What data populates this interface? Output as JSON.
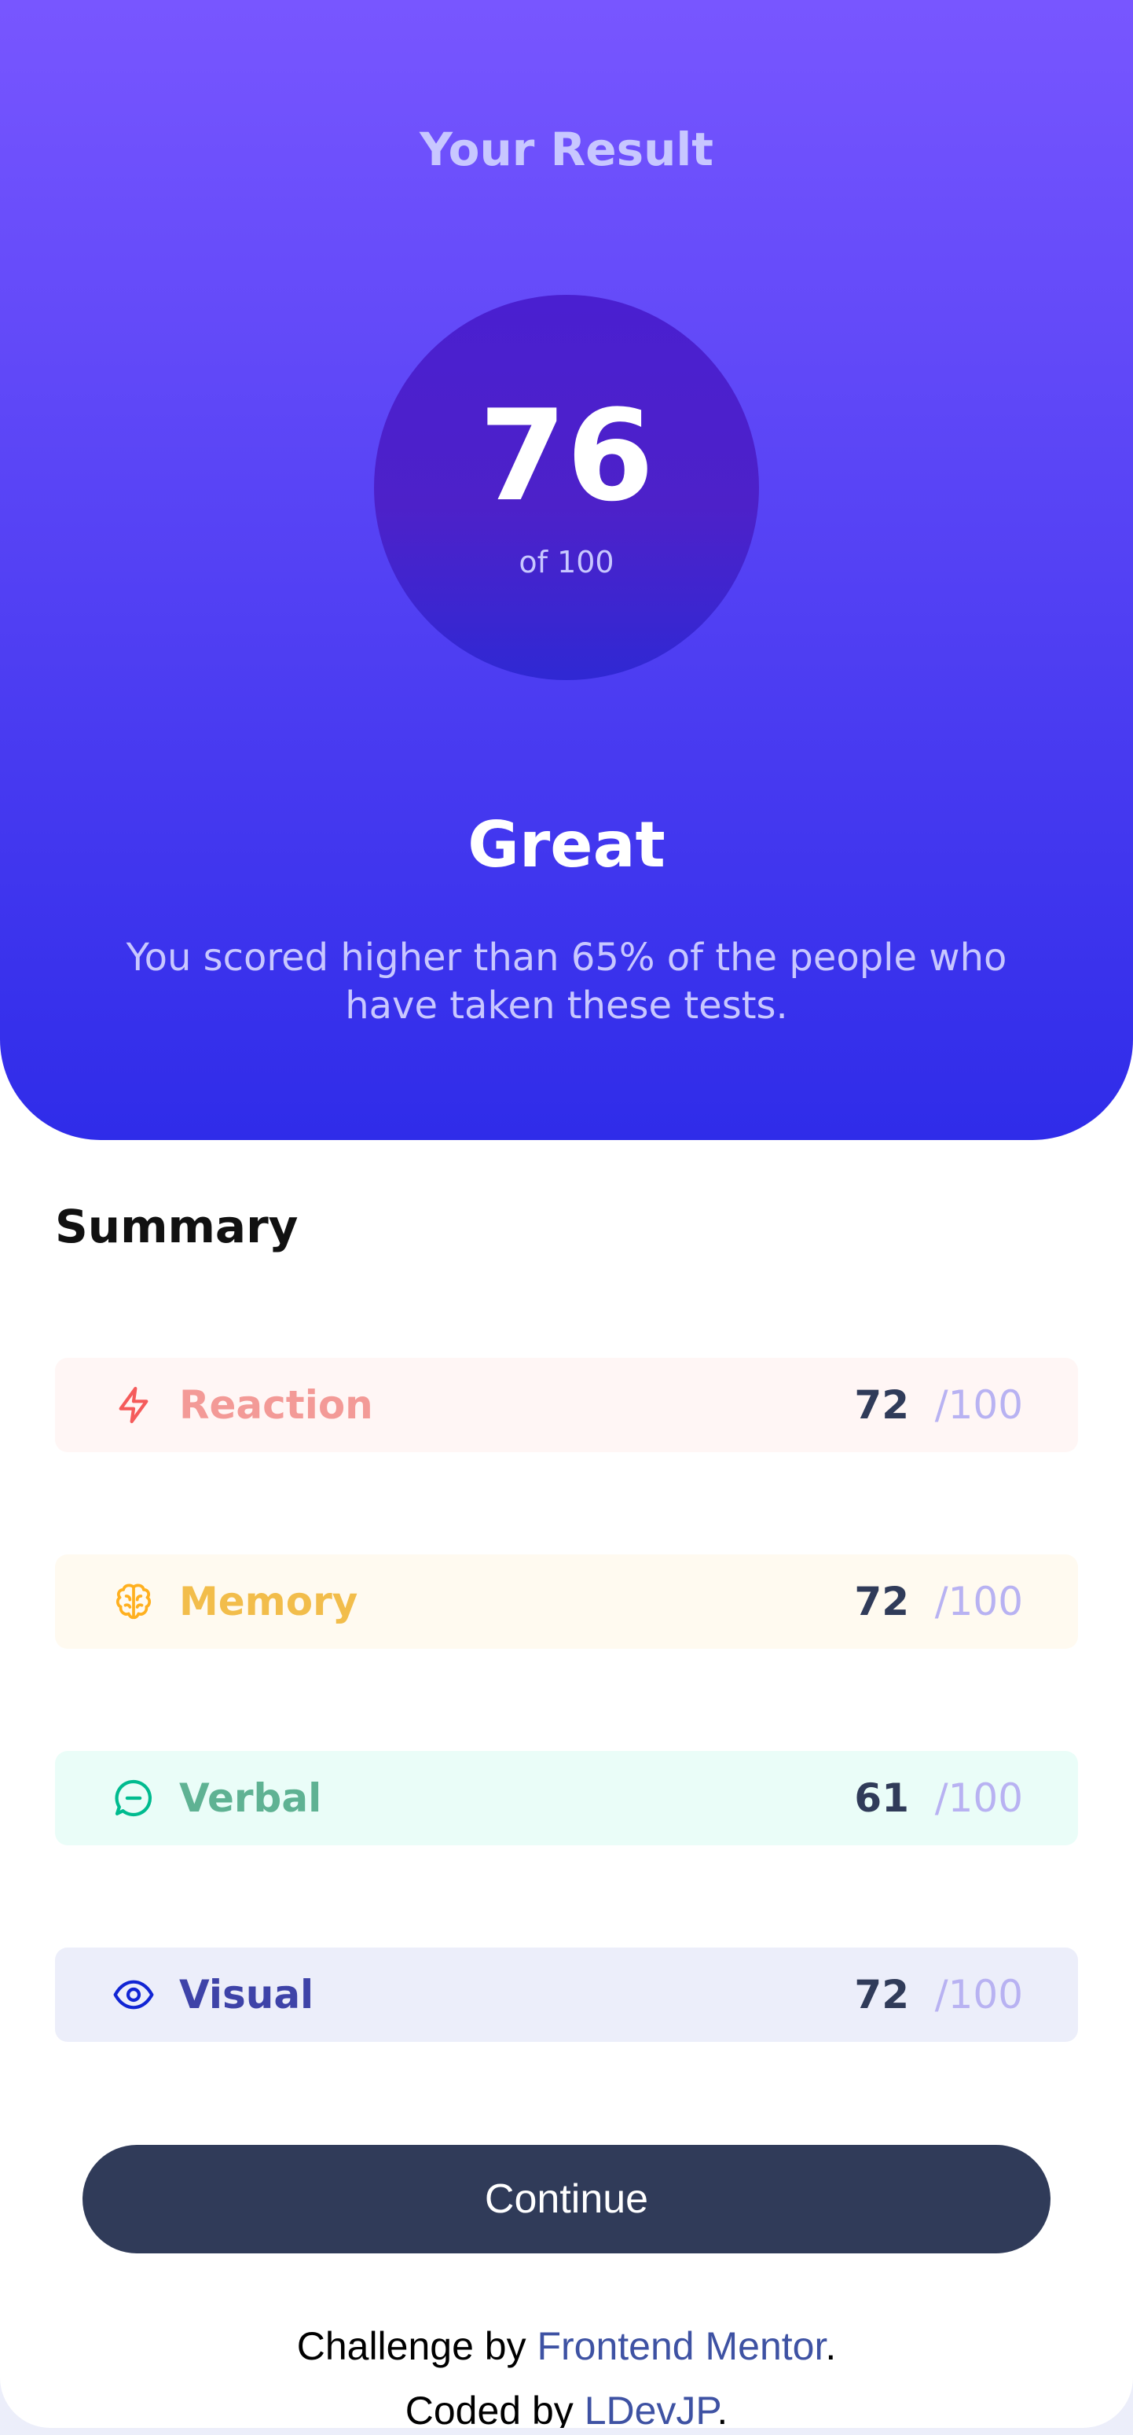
{
  "result": {
    "title": "Your Result",
    "score": "76",
    "of_label": "of 100",
    "rating": "Great",
    "description": "You scored higher than 65% of the people who have taken these tests."
  },
  "summary": {
    "title": "Summary",
    "items": [
      {
        "label": "Reaction",
        "score": "72",
        "max": "/100",
        "icon": "lightning-icon",
        "color": "#F55B5B",
        "background": "#FFF6F5"
      },
      {
        "label": "Memory",
        "score": "72",
        "max": "/100",
        "icon": "brain-icon",
        "color": "#FFB01F",
        "background": "#FFFAF0"
      },
      {
        "label": "Verbal",
        "score": "61",
        "max": "/100",
        "icon": "speech-bubble-icon",
        "color": "#00BB8F",
        "background": "#EAFDF8"
      },
      {
        "label": "Visual",
        "score": "72",
        "max": "/100",
        "icon": "eye-icon",
        "color": "#1125D4",
        "background": "#ECEEFA"
      }
    ]
  },
  "continue_button": "Continue",
  "attribution": {
    "line1_prefix": "Challenge by ",
    "line1_link": "Frontend Mentor",
    "line1_suffix": ".",
    "line2_prefix": "Coded by ",
    "line2_link": "LDevJP",
    "line2_suffix": "."
  },
  "colors": {
    "gradient_top": "#7856FF",
    "gradient_bottom": "#2F2CE9",
    "circle": "#4A1FD0",
    "button": "#303B59",
    "link": "#3E52A3"
  }
}
